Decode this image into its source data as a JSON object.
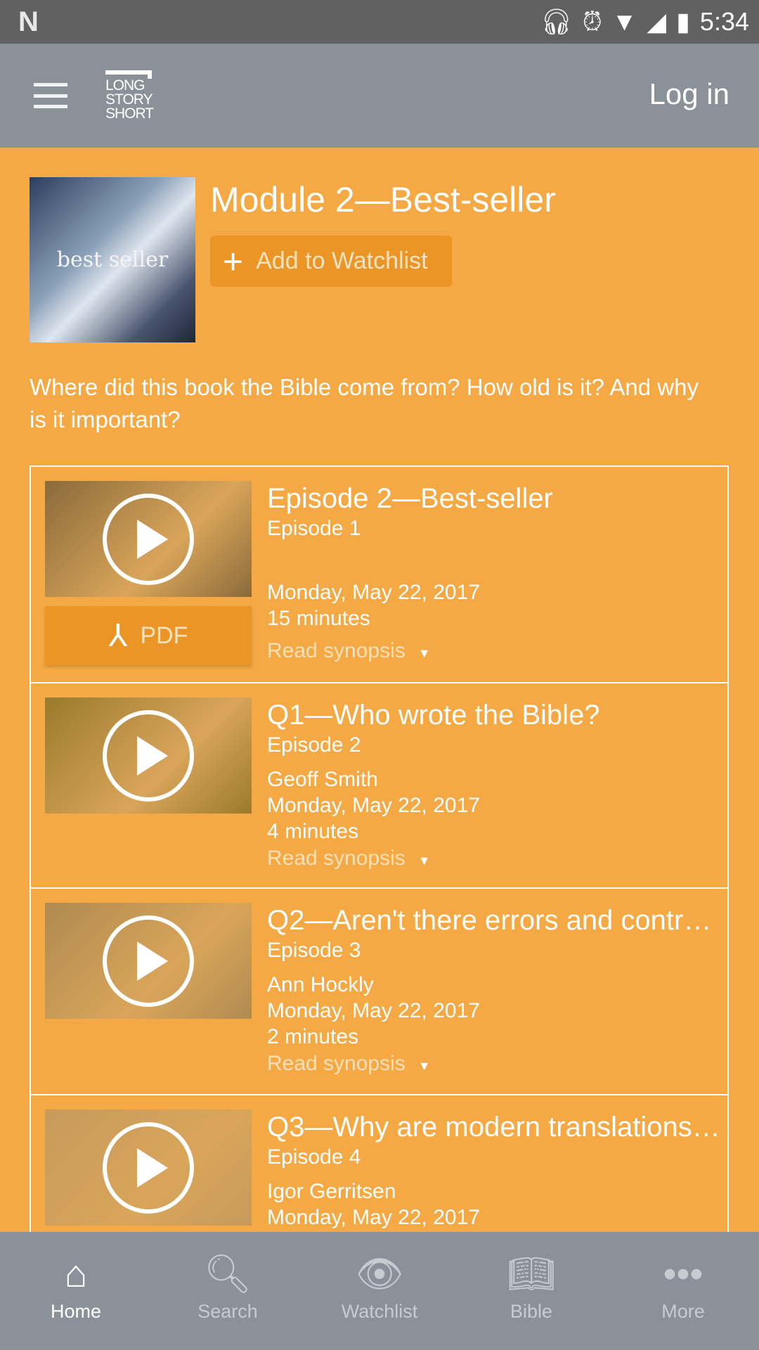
{
  "status_bar": {
    "time": "5:34",
    "icons": [
      "notification-n-icon",
      "headphones-icon",
      "alarm-icon",
      "wifi-icon",
      "signal-icon",
      "battery-charging-icon"
    ]
  },
  "app_bar": {
    "logo": "LONG STORY SHORT",
    "login": "Log in"
  },
  "module": {
    "title": "Module 2—Best-seller",
    "thumb_text": "best seller",
    "watchlist_button": "Add to Watchlist",
    "description": "Where did this book the Bible come from? How old is it? And why is it important?"
  },
  "episodes": [
    {
      "title": "Episode 2—Best-seller",
      "episode": "Episode 1",
      "author": "",
      "date": "Monday, May 22, 2017",
      "duration": "15 minutes",
      "synopsis": "Read synopsis",
      "pdf": "PDF",
      "thumb": "#8a6a3a"
    },
    {
      "title": "Q1—Who wrote the Bible?",
      "episode": "Episode 2",
      "author": "Geoff Smith",
      "date": "Monday, May 22, 2017",
      "duration": "4 minutes",
      "synopsis": "Read synopsis",
      "thumb": "#9a7a2c"
    },
    {
      "title": "Q2—Aren't there errors and contr…",
      "episode": "Episode 3",
      "author": "Ann Hockly",
      "date": "Monday, May 22, 2017",
      "duration": "2 minutes",
      "synopsis": "Read synopsis",
      "thumb": "#b08a50"
    },
    {
      "title": "Q3—Why are modern translations…",
      "episode": "Episode 4",
      "author": "Igor Gerritsen",
      "date": "Monday, May 22, 2017",
      "duration": "",
      "synopsis": "",
      "thumb": "#c79a5c"
    }
  ],
  "bottom_nav": [
    {
      "label": "Home",
      "icon": "home-icon",
      "active": true
    },
    {
      "label": "Search",
      "icon": "search-icon"
    },
    {
      "label": "Watchlist",
      "icon": "eye-icon"
    },
    {
      "label": "Bible",
      "icon": "book-icon"
    },
    {
      "label": "More",
      "icon": "more-icon"
    }
  ],
  "colors": {
    "background": "#F4A944",
    "app_bar": "#8A9199",
    "status_bar": "#616161",
    "button": "#EC9527"
  }
}
